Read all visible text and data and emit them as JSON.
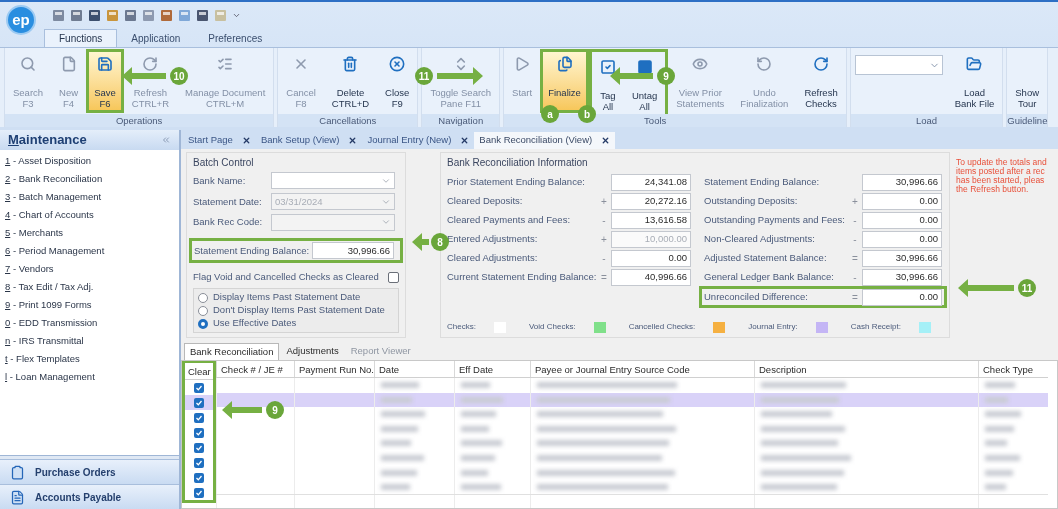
{
  "app": {
    "logo": "ep"
  },
  "ribbon_tabs": [
    {
      "label": "Functions",
      "selected": true
    },
    {
      "label": "Application",
      "selected": false
    },
    {
      "label": "Preferences",
      "selected": false
    }
  ],
  "ribbon_groups": [
    {
      "label": "Operations",
      "buttons": [
        {
          "kind": "button",
          "lines": [
            "Search",
            "F3"
          ],
          "disabled": true,
          "active": false,
          "highlighted": false
        },
        {
          "kind": "button",
          "lines": [
            "New",
            "F4"
          ],
          "disabled": true,
          "active": false,
          "highlighted": false
        },
        {
          "kind": "button",
          "lines": [
            "Save",
            "F6"
          ],
          "disabled": false,
          "active": true,
          "highlighted": true
        },
        {
          "kind": "button",
          "lines": [
            "Refresh",
            "CTRL+R"
          ],
          "disabled": true,
          "active": false,
          "highlighted": false
        },
        {
          "kind": "button",
          "lines": [
            "Manage Document",
            "CTRL+M"
          ],
          "disabled": true,
          "active": false,
          "highlighted": false
        }
      ]
    },
    {
      "label": "Cancellations",
      "buttons": [
        {
          "kind": "button",
          "lines": [
            "Cancel",
            "F8"
          ],
          "disabled": true,
          "active": false,
          "highlighted": false
        },
        {
          "kind": "button",
          "lines": [
            "Delete",
            "CTRL+D"
          ],
          "disabled": false,
          "active": false,
          "highlighted": false
        },
        {
          "kind": "button",
          "lines": [
            "Close",
            "F9"
          ],
          "disabled": false,
          "active": false,
          "highlighted": false
        }
      ]
    },
    {
      "label": "Navigation",
      "buttons": [
        {
          "kind": "button",
          "lines": [
            "Toggle Search",
            "Pane F11"
          ],
          "disabled": true,
          "active": false,
          "highlighted": false
        }
      ]
    },
    {
      "label": "Tools",
      "buttons": [
        {
          "kind": "button",
          "lines": [
            "Start"
          ],
          "disabled": true,
          "active": false,
          "highlighted": false
        },
        {
          "kind": "button",
          "lines": [
            "Finalize"
          ],
          "disabled": false,
          "active": true,
          "highlighted": true
        },
        {
          "kind": "set",
          "highlighted": true,
          "buttons": [
            {
              "kind": "button",
              "lines": [
                "Tag",
                "All"
              ],
              "disabled": false,
              "active": false,
              "highlighted": false
            },
            {
              "kind": "button",
              "lines": [
                "Untag",
                "All"
              ],
              "disabled": false,
              "active": false,
              "highlighted": false
            }
          ]
        },
        {
          "kind": "button",
          "lines": [
            "View Prior",
            "Statements"
          ],
          "disabled": true,
          "active": false,
          "highlighted": false
        },
        {
          "kind": "button",
          "lines": [
            "Undo",
            "Finalization"
          ],
          "disabled": true,
          "active": false,
          "highlighted": false
        },
        {
          "kind": "button",
          "lines": [
            "Refresh",
            "Checks"
          ],
          "disabled": false,
          "active": false,
          "highlighted": false
        }
      ]
    },
    {
      "label": "Load",
      "buttons": [
        {
          "kind": "dropdown"
        },
        {
          "kind": "button",
          "lines": [
            "Load",
            "Bank File"
          ],
          "disabled": false,
          "active": false,
          "highlighted": false
        }
      ]
    },
    {
      "label": "Guideline",
      "buttons": [
        {
          "kind": "button",
          "lines": [
            "Show",
            "Tour"
          ],
          "disabled": false,
          "active": false,
          "highlighted": false
        }
      ]
    }
  ],
  "sidebar": {
    "title": "Maintenance",
    "items": [
      {
        "label": "1 - Asset Disposition"
      },
      {
        "label": "2 - Bank Reconciliation"
      },
      {
        "label": "3 - Batch Management"
      },
      {
        "label": "4 - Chart of Accounts"
      },
      {
        "label": "5 - Merchants"
      },
      {
        "label": "6 - Period Management"
      },
      {
        "label": "7 - Vendors"
      },
      {
        "label": "8 - Tax Edit / Tax Adj."
      },
      {
        "label": "9 - Print 1099 Forms"
      },
      {
        "label": "0 - EDD Transmission"
      },
      {
        "label": "n - IRS Transmittal"
      },
      {
        "label": "t - Flex Templates"
      },
      {
        "label": "l - Loan Management"
      }
    ],
    "modules": [
      {
        "label": "Purchase Orders"
      },
      {
        "label": "Accounts Payable"
      }
    ]
  },
  "doc_tabs": [
    {
      "label": "Start Page",
      "selected": false
    },
    {
      "label": "Bank Setup (View)",
      "selected": false
    },
    {
      "label": "Journal Entry (New)",
      "selected": false
    },
    {
      "label": "Bank Reconciliation (View)",
      "selected": true
    }
  ],
  "batch_control": {
    "title": "Batch Control",
    "fields": [
      {
        "label": "Bank Name:",
        "disabled": false
      },
      {
        "label": "Statement Date:",
        "value": "03/31/2024",
        "disabled": true
      },
      {
        "label": "Bank Rec Code:",
        "disabled": true
      }
    ],
    "ending_balance": {
      "label": "Statement Ending Balance:",
      "value": "30,996.66",
      "highlighted": true
    },
    "flag": {
      "label": "Flag Void and Cancelled Checks as Cleared",
      "checked": false
    },
    "options": [
      {
        "label": "Display Items Past Statement Date",
        "selected": false
      },
      {
        "label": "Don't Display Items Past Statement Date",
        "selected": false
      },
      {
        "label": "Use Effective Dates",
        "selected": true
      }
    ]
  },
  "reconciliation": {
    "title": "Bank Reconciliation Information",
    "left": [
      {
        "label": "Prior Statement Ending Balance:",
        "value": "24,341.08",
        "disabled": false,
        "highlighted": false
      },
      {
        "label": "Cleared Deposits:",
        "sign": "+",
        "value": "20,272.16",
        "disabled": false,
        "highlighted": false
      },
      {
        "label": "Cleared Payments and Fees:",
        "sign": "-",
        "value": "13,616.58",
        "disabled": false,
        "highlighted": false
      },
      {
        "label": "Entered Adjustments:",
        "sign": "+",
        "value": "10,000.00",
        "disabled": true,
        "highlighted": false
      },
      {
        "label": "Cleared Adjustments:",
        "sign": "-",
        "value": "0.00",
        "disabled": false,
        "highlighted": false
      },
      {
        "label": "Current Statement Ending Balance:",
        "sign": "=",
        "value": "40,996.66",
        "disabled": false,
        "highlighted": false
      }
    ],
    "right": [
      {
        "label": "Statement Ending Balance:",
        "value": "30,996.66",
        "disabled": false,
        "highlighted": false
      },
      {
        "label": "Outstanding Deposits:",
        "sign": "+",
        "value": "0.00",
        "disabled": false,
        "highlighted": false
      },
      {
        "label": "Outstanding Payments and Fees:",
        "sign": "-",
        "value": "0.00",
        "disabled": false,
        "highlighted": false
      },
      {
        "label": "Non-Cleared Adjustments:",
        "sign": "-",
        "value": "0.00",
        "disabled": false,
        "highlighted": false
      },
      {
        "label": "Adjusted Statement Balance:",
        "sign": "=",
        "value": "30,996.66",
        "disabled": false,
        "highlighted": false
      },
      {
        "label": "General Ledger Bank Balance:",
        "sign": "-",
        "value": "30,996.66",
        "disabled": false,
        "highlighted": false
      },
      {
        "label": "Unreconciled Difference:",
        "sign": "=",
        "value": "0.00",
        "disabled": false,
        "highlighted": true
      }
    ],
    "legend": [
      {
        "label": "Checks:",
        "color": "#ffffff"
      },
      {
        "label": "Void Checks:",
        "color": "#80e08a"
      },
      {
        "label": "Cancelled Checks:",
        "color": "#f5b041"
      },
      {
        "label": "Journal Entry:",
        "color": "#c4b5f5"
      },
      {
        "label": "Cash Receipt:",
        "color": "#a5f0f7"
      }
    ]
  },
  "note": [
    "To update the totals and",
    "items posted after a rec",
    "has been started, pleas",
    "the Refresh button."
  ],
  "lower_tabs": [
    {
      "label": "Bank Reconciliation",
      "selected": true,
      "disabled": false
    },
    {
      "label": "Adjustments",
      "selected": false,
      "disabled": false
    },
    {
      "label": "Report Viewer",
      "selected": false,
      "disabled": true
    }
  ],
  "table": {
    "clear_highlighted": true,
    "columns": [
      "Clear",
      "Check # / JE #",
      "Payment Run No.",
      "Date",
      "Eff Date",
      "Payee or Journal Entry Source Code",
      "Description",
      "Check Type"
    ],
    "rows": [
      {
        "clear": true,
        "selected": false
      },
      {
        "clear": true,
        "selected": true
      },
      {
        "clear": true,
        "selected": false
      },
      {
        "clear": true,
        "selected": false
      },
      {
        "clear": true,
        "selected": false
      },
      {
        "clear": true,
        "selected": false
      },
      {
        "clear": true,
        "selected": false
      },
      {
        "clear": true,
        "selected": false
      }
    ]
  },
  "callouts": [
    {
      "label": "10"
    },
    {
      "label": "11"
    },
    {
      "label": "9"
    },
    {
      "label": "a"
    },
    {
      "label": "b"
    },
    {
      "label": "8"
    },
    {
      "label": "11"
    },
    {
      "label": "9"
    }
  ]
}
